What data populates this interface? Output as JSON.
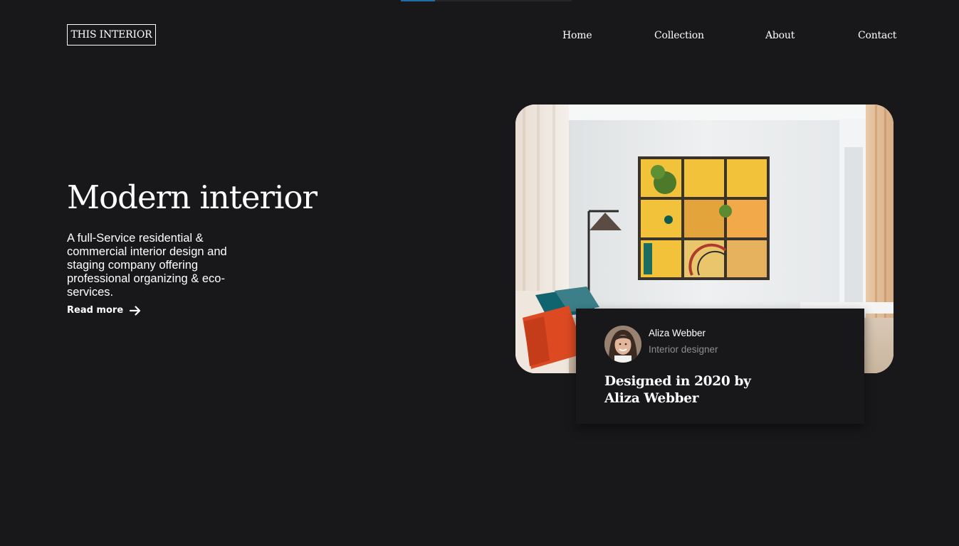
{
  "header": {
    "logo": "THIS INTERIOR",
    "nav": [
      {
        "label": "Home"
      },
      {
        "label": "Collection"
      },
      {
        "label": "About"
      },
      {
        "label": "Contact"
      }
    ]
  },
  "hero": {
    "title": "Modern interior",
    "description": "A full-Service residential & commercial interior design and staging company offering professional organizing & eco-services.",
    "read_more": "Read more",
    "read_more_icon": "arrow-right-icon"
  },
  "feature": {
    "image": "living-room-photo",
    "author_name": "Aliza Webber",
    "author_role": "Interior designer",
    "title": "Designed in 2020 by Aliza Webber"
  },
  "colors": {
    "background": "#18181b",
    "text": "#ffffff",
    "muted": "#8f8f93",
    "accent": "#1d6fa5"
  }
}
